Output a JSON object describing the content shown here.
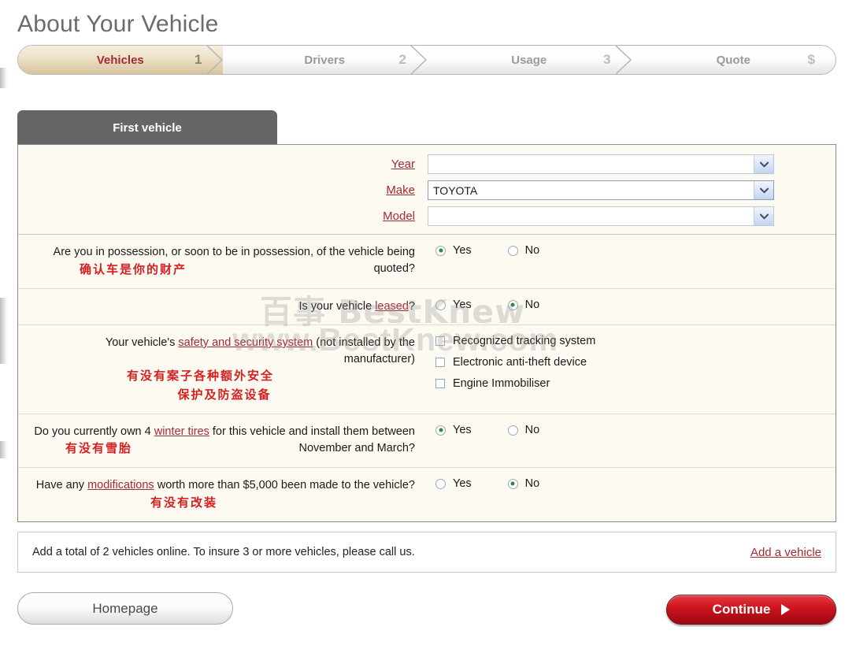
{
  "page": {
    "title": "About Your Vehicle"
  },
  "progress": {
    "steps": [
      {
        "label": "Vehicles",
        "num": "1",
        "active": true
      },
      {
        "label": "Drivers",
        "num": "2",
        "active": false
      },
      {
        "label": "Usage",
        "num": "3",
        "active": false
      },
      {
        "label": "Quote",
        "num": "$",
        "active": false
      }
    ]
  },
  "panel": {
    "tab_label": "First vehicle",
    "selects": [
      {
        "label": "Year",
        "value": "",
        "faded": true
      },
      {
        "label": "Make",
        "value": "TOYOTA",
        "faded": false
      },
      {
        "label": "Model",
        "value": "",
        "faded": true
      }
    ],
    "questions": [
      {
        "text_before": "Are you in possession, or soon to be in possession, of the vehicle being quoted?",
        "cn": "确认车是你的财产",
        "type": "radio",
        "options": [
          {
            "label": "Yes",
            "selected": true
          },
          {
            "label": "No",
            "selected": false
          }
        ]
      },
      {
        "text_before": "Is your vehicle ",
        "link": "leased",
        "text_after": "?",
        "cn": "",
        "type": "radio",
        "options": [
          {
            "label": "Yes",
            "selected": false
          },
          {
            "label": "No",
            "selected": true
          }
        ]
      },
      {
        "text_before": "Your vehicle's ",
        "link": "safety and security system",
        "text_after": " (not installed by the manufacturer)",
        "cn": "有没有案子各种额外安全",
        "cn2": "保护及防盗设备",
        "type": "checkbox",
        "options": [
          {
            "label": "Recognized tracking system",
            "checked": false
          },
          {
            "label": "Electronic anti-theft device",
            "checked": false
          },
          {
            "label": "Engine Immobiliser",
            "checked": false
          }
        ]
      },
      {
        "text_before": "Do you currently own 4 ",
        "link": "winter tires",
        "text_after": " for this vehicle and install them between November and March?",
        "cn": "有没有雪胎",
        "type": "radio",
        "options": [
          {
            "label": "Yes",
            "selected": true
          },
          {
            "label": "No",
            "selected": false
          }
        ]
      },
      {
        "text_before": "Have any ",
        "link": "modifications",
        "text_after": " worth more than $5,000 been made to the vehicle?",
        "cn": "有没有改装",
        "type": "radio",
        "options": [
          {
            "label": "Yes",
            "selected": false
          },
          {
            "label": "No",
            "selected": true
          }
        ]
      }
    ]
  },
  "addbar": {
    "text": "Add a total of 2 vehicles online. To insure 3 or more vehicles, please call us.",
    "link": "Add a vehicle"
  },
  "footer": {
    "homepage_label": "Homepage",
    "continue_label": "Continue"
  },
  "watermark": {
    "line1": "百事 BestKnew",
    "line2": "www.BestKnew.com"
  },
  "colors": {
    "accent_link": "#a32a36",
    "cn_red": "#d52020",
    "panel_bg": "#fdfaf2",
    "tab_header": "#666666",
    "continue_red": "#d11822",
    "radio_dot_green": "#2e8b35"
  }
}
